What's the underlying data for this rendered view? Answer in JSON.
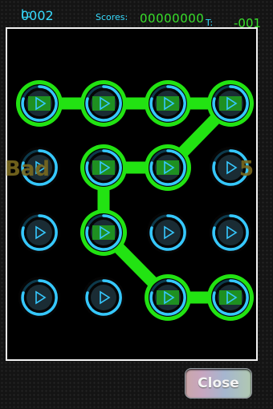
{
  "hud": {
    "level_label": "L:",
    "level_value": "0002",
    "scores_label": "Scores:",
    "scores_value": "00000000",
    "time_label": "T:",
    "time_value": "-001"
  },
  "feedback": {
    "text_left": "Bad",
    "text_right": "5"
  },
  "grid": {
    "rows": 4,
    "cols": 4
  },
  "path": [
    [
      0,
      0
    ],
    [
      0,
      1
    ],
    [
      0,
      2
    ],
    [
      0,
      3
    ],
    [
      1,
      2
    ],
    [
      1,
      1
    ],
    [
      2,
      1
    ],
    [
      3,
      2
    ],
    [
      3,
      3
    ]
  ],
  "button": {
    "close_label": "Close"
  },
  "colors": {
    "path": "#22e312",
    "ring": "#36c8ff",
    "hud_label": "#37dcff",
    "hud_value": "#38e02a"
  }
}
